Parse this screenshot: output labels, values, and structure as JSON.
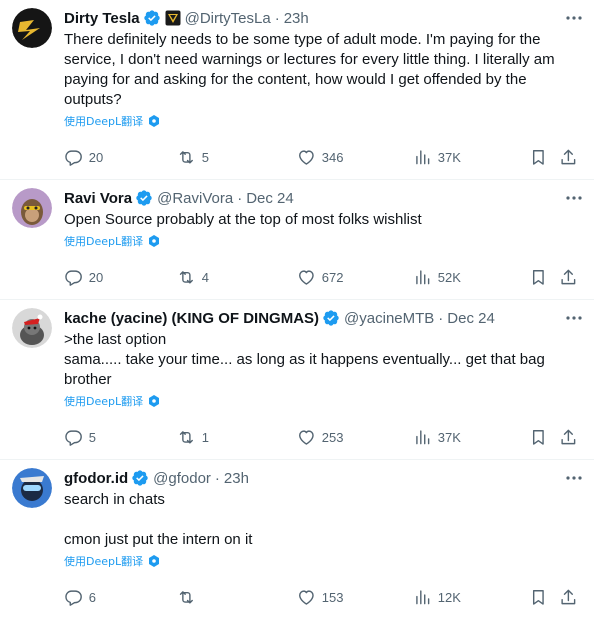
{
  "tweets": [
    {
      "name": "Dirty Tesla",
      "handle": "@DirtyTesLa",
      "time": "23h",
      "text": "There definitely needs to be some type of adult mode. I'm paying for the service, I don't need warnings or lectures for every little thing. I literally am paying for and asking for the content, how would I get offended by the outputs?",
      "translate": "使用DeepL翻译",
      "replies": "20",
      "reposts": "5",
      "likes": "346",
      "views": "37K"
    },
    {
      "name": "Ravi Vora",
      "handle": "@RaviVora",
      "time": "Dec 24",
      "text": "Open Source probably at the top of most folks wishlist",
      "translate": "使用DeepL翻译",
      "replies": "20",
      "reposts": "4",
      "likes": "672",
      "views": "52K"
    },
    {
      "name": "kache (yacine) (KING OF DINGMAS)",
      "handle": "@yacineMTB",
      "time": "Dec 24",
      "text": ">the last option\nsama..... take your time... as long as it happens eventually... get that bag brother",
      "translate": "使用DeepL翻译",
      "replies": "5",
      "reposts": "1",
      "likes": "253",
      "views": "37K"
    },
    {
      "name": "gfodor.id",
      "handle": "@gfodor",
      "time": "23h",
      "text": "search in chats\n\ncmon just put the intern on it",
      "translate": "使用DeepL翻译",
      "replies": "6",
      "reposts": "",
      "likes": "153",
      "views": "12K"
    }
  ],
  "separator": "·",
  "icons": {
    "verified": "verified-badge-icon",
    "affiliate": "tesla-affiliate-icon",
    "more": "more-icon",
    "translate": "deepl-icon",
    "reply": "reply-icon",
    "repost": "repost-icon",
    "like": "like-icon",
    "views": "views-icon",
    "bookmark": "bookmark-icon",
    "share": "share-icon"
  },
  "colors": {
    "text": "#0f1419",
    "secondary": "#536471",
    "link": "#1d9bf0",
    "verified": "#1d9bf0",
    "divider": "#eff3f4"
  }
}
